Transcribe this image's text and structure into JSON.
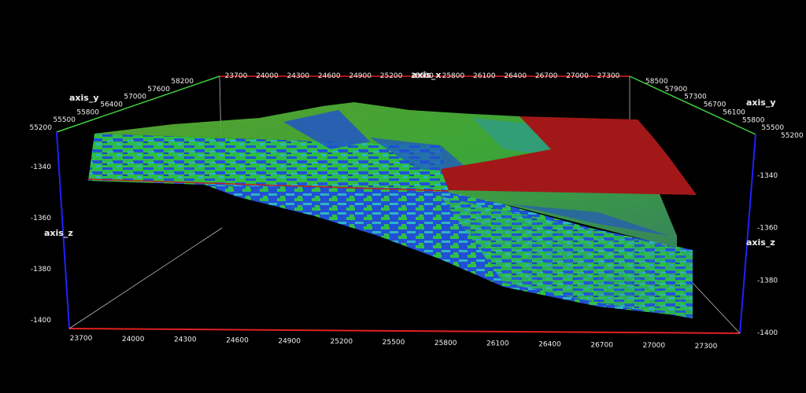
{
  "axes": {
    "x_label": "axis_x",
    "y_label_left": "axis_y",
    "y_label_right": "axis_y",
    "z_label_left": "axis_z",
    "z_label_right": "axis_z",
    "x_ticks_top": [
      "23700",
      "24000",
      "24300",
      "24600",
      "24900",
      "25200",
      "25500",
      "25800",
      "26100",
      "26400",
      "26700",
      "27000",
      "27300"
    ],
    "x_ticks_bottom": [
      "23700",
      "24000",
      "24300",
      "24600",
      "24900",
      "25200",
      "25500",
      "25800",
      "26100",
      "26400",
      "26700",
      "27000",
      "27300"
    ],
    "y_ticks_left": [
      "55200",
      "55500",
      "55800",
      "56400",
      "57000",
      "57600",
      "58200"
    ],
    "y_ticks_right": [
      "58500",
      "57900",
      "57300",
      "56700",
      "56100",
      "55800",
      "55500",
      "55200"
    ],
    "z_ticks_left": [
      "-1340",
      "-1360",
      "-1380",
      "-1400"
    ],
    "z_ticks_right": [
      "-1340",
      "-1360",
      "-1380",
      "-1400"
    ]
  },
  "colors": {
    "background": "#000000",
    "x_axis": "#e02020",
    "y_axis": "#40d040",
    "z_axis": "#2020ff",
    "surface_green": "#30c040",
    "surface_blue": "#2050d0",
    "surface_cyan": "#30b0c0",
    "fault_plane": "#a01818"
  }
}
